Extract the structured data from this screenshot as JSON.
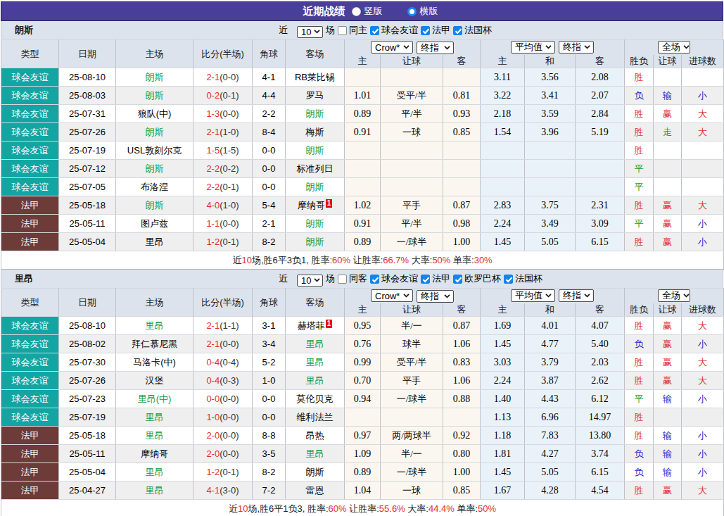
{
  "title_bar": {
    "title": "近期战绩",
    "radios": [
      {
        "label": "竖版",
        "selected": false
      },
      {
        "label": "横版",
        "selected": true
      }
    ]
  },
  "table_header": {
    "left_cols": [
      "类型",
      "日期",
      "主场",
      "比分(半场)",
      "角球",
      "客场"
    ],
    "odds_group": {
      "selects": [
        "Crow*",
        "终指"
      ],
      "cols": [
        "主",
        "让球",
        "客"
      ]
    },
    "avg_group": {
      "selects": [
        "平均值",
        "终指"
      ],
      "cols": [
        "主",
        "和",
        "客"
      ]
    },
    "result_group": {
      "selects": [
        "全场"
      ],
      "cols": [
        "胜负",
        "让球",
        "进球数"
      ]
    }
  },
  "sections": [
    {
      "team": "朗斯",
      "filter": {
        "near_label": "近",
        "count": "10",
        "unit_label": "场",
        "checkboxes": [
          {
            "label": "同主",
            "checked": false
          },
          {
            "label": "球会友谊",
            "checked": true
          },
          {
            "label": "法甲",
            "checked": true
          },
          {
            "label": "法国杯",
            "checked": true
          }
        ]
      },
      "rows": [
        {
          "type": "球会友谊",
          "type_class": "friendly",
          "date": "25-08-10",
          "home": "朗斯",
          "home_focal": true,
          "score_ft": "2-1",
          "score_ht": "(0-0)",
          "corner": "4-1",
          "away": "RB莱比锡",
          "away_focal": false,
          "away_sup": "",
          "odds": [
            "",
            "",
            ""
          ],
          "avg": [
            "3.11",
            "3.56",
            "2.08"
          ],
          "results": [
            [
              "胜",
              "red"
            ],
            [
              "",
              ""
            ],
            [
              "",
              ""
            ]
          ]
        },
        {
          "type": "球会友谊",
          "type_class": "friendly",
          "date": "25-08-03",
          "home": "朗斯",
          "home_focal": true,
          "score_ft": "0-2",
          "score_ht": "(0-1)",
          "corner": "4-4",
          "away": "罗马",
          "away_focal": false,
          "away_sup": "",
          "odds": [
            "1.01",
            "受平/半",
            "0.81"
          ],
          "avg": [
            "3.22",
            "3.41",
            "2.07"
          ],
          "results": [
            [
              "负",
              "blue"
            ],
            [
              "输",
              "blue"
            ],
            [
              "小",
              "blue"
            ]
          ]
        },
        {
          "type": "球会友谊",
          "type_class": "friendly",
          "date": "25-07-31",
          "home": "狼队(中)",
          "home_focal": false,
          "score_ft": "1-3",
          "score_ht": "(0-0)",
          "corner": "2-2",
          "away": "朗斯",
          "away_focal": true,
          "away_sup": "",
          "odds": [
            "0.89",
            "平/半",
            "0.93"
          ],
          "avg": [
            "2.18",
            "3.59",
            "2.84"
          ],
          "results": [
            [
              "胜",
              "red"
            ],
            [
              "赢",
              "red"
            ],
            [
              "大",
              "red"
            ]
          ]
        },
        {
          "type": "球会友谊",
          "type_class": "friendly",
          "date": "25-07-26",
          "home": "朗斯",
          "home_focal": true,
          "score_ft": "2-1",
          "score_ht": "(1-0)",
          "corner": "8-4",
          "away": "梅斯",
          "away_focal": false,
          "away_sup": "",
          "odds": [
            "0.91",
            "一球",
            "0.85"
          ],
          "avg": [
            "1.54",
            "3.96",
            "5.19"
          ],
          "results": [
            [
              "胜",
              "red"
            ],
            [
              "走",
              "green"
            ],
            [
              "大",
              "red"
            ]
          ]
        },
        {
          "type": "球会友谊",
          "type_class": "friendly",
          "date": "25-07-19",
          "home": "USL敦刻尔克",
          "home_focal": false,
          "score_ft": "1-5",
          "score_ht": "(1-5)",
          "corner": "0-0",
          "away": "朗斯",
          "away_focal": true,
          "away_sup": "",
          "odds": [
            "",
            "",
            ""
          ],
          "avg": [
            "",
            "",
            ""
          ],
          "results": [
            [
              "胜",
              "red"
            ],
            [
              "",
              ""
            ],
            [
              "",
              ""
            ]
          ]
        },
        {
          "type": "球会友谊",
          "type_class": "friendly",
          "date": "25-07-12",
          "home": "朗斯",
          "home_focal": true,
          "score_ft": "2-2",
          "score_ht": "(0-2)",
          "corner": "0-0",
          "away": "标准列日",
          "away_focal": false,
          "away_sup": "",
          "odds": [
            "",
            "",
            ""
          ],
          "avg": [
            "",
            "",
            ""
          ],
          "results": [
            [
              "平",
              "green"
            ],
            [
              "",
              ""
            ],
            [
              "",
              ""
            ]
          ]
        },
        {
          "type": "球会友谊",
          "type_class": "friendly",
          "date": "25-07-05",
          "home": "布洛涅",
          "home_focal": false,
          "score_ft": "2-2",
          "score_ht": "(0-1)",
          "corner": "0-0",
          "away": "朗斯",
          "away_focal": true,
          "away_sup": "",
          "odds": [
            "",
            "",
            ""
          ],
          "avg": [
            "",
            "",
            ""
          ],
          "results": [
            [
              "平",
              "green"
            ],
            [
              "",
              ""
            ],
            [
              "",
              ""
            ]
          ]
        },
        {
          "type": "法甲",
          "type_class": "ligue1",
          "date": "25-05-18",
          "home": "朗斯",
          "home_focal": true,
          "score_ft": "4-0",
          "score_ht": "(1-0)",
          "corner": "5-4",
          "away": "摩纳哥",
          "away_focal": false,
          "away_sup": "1",
          "odds": [
            "1.02",
            "平手",
            "0.87"
          ],
          "avg": [
            "2.83",
            "3.75",
            "2.31"
          ],
          "results": [
            [
              "胜",
              "red"
            ],
            [
              "赢",
              "red"
            ],
            [
              "大",
              "red"
            ]
          ]
        },
        {
          "type": "法甲",
          "type_class": "ligue1",
          "date": "25-05-11",
          "home": "图卢兹",
          "home_focal": false,
          "score_ft": "1-1",
          "score_ht": "(0-0)",
          "corner": "2-1",
          "away": "朗斯",
          "away_focal": true,
          "away_sup": "",
          "odds": [
            "0.91",
            "平/半",
            "0.98"
          ],
          "avg": [
            "2.24",
            "3.49",
            "3.09"
          ],
          "results": [
            [
              "平",
              "green"
            ],
            [
              "赢",
              "red"
            ],
            [
              "小",
              "blue"
            ]
          ]
        },
        {
          "type": "法甲",
          "type_class": "ligue1",
          "date": "25-05-04",
          "home": "里昂",
          "home_focal": false,
          "score_ft": "1-2",
          "score_ht": "(0-1)",
          "corner": "8-2",
          "away": "朗斯",
          "away_focal": true,
          "away_sup": "",
          "odds": [
            "0.89",
            "一/球半",
            "1.00"
          ],
          "avg": [
            "1.45",
            "5.05",
            "6.15"
          ],
          "results": [
            [
              "胜",
              "red"
            ],
            [
              "赢",
              "red"
            ],
            [
              "小",
              "blue"
            ]
          ]
        }
      ],
      "summary": [
        [
          "近",
          ""
        ],
        [
          "10",
          "red"
        ],
        [
          "场,胜6平3负1, 胜率:",
          ""
        ],
        [
          "60%",
          "red"
        ],
        [
          " 让胜率:",
          ""
        ],
        [
          "66.7%",
          "red"
        ],
        [
          " 大率:",
          ""
        ],
        [
          "50%",
          "red"
        ],
        [
          " 单率:",
          ""
        ],
        [
          "30%",
          "red"
        ]
      ]
    },
    {
      "team": "里昂",
      "filter": {
        "near_label": "近",
        "count": "10",
        "unit_label": "场",
        "checkboxes": [
          {
            "label": "同客",
            "checked": false
          },
          {
            "label": "球会友谊",
            "checked": true
          },
          {
            "label": "法甲",
            "checked": true
          },
          {
            "label": "欧罗巴杯",
            "checked": true
          },
          {
            "label": "法国杯",
            "checked": true
          }
        ]
      },
      "rows": [
        {
          "type": "球会友谊",
          "type_class": "friendly",
          "date": "25-08-10",
          "home": "里昂",
          "home_focal": true,
          "score_ft": "2-1",
          "score_ht": "(1-1)",
          "corner": "3-1",
          "away": "赫塔菲",
          "away_focal": false,
          "away_sup": "1",
          "odds": [
            "0.95",
            "半/一",
            "0.87"
          ],
          "avg": [
            "1.69",
            "4.01",
            "4.07"
          ],
          "results": [
            [
              "胜",
              "red"
            ],
            [
              "赢",
              "red"
            ],
            [
              "大",
              "red"
            ]
          ]
        },
        {
          "type": "球会友谊",
          "type_class": "friendly",
          "date": "25-08-02",
          "home": "拜仁慕尼黑",
          "home_focal": false,
          "score_ft": "2-1",
          "score_ht": "(0-0)",
          "corner": "3-4",
          "away": "里昂",
          "away_focal": true,
          "away_sup": "",
          "odds": [
            "0.76",
            "球半",
            "1.06"
          ],
          "avg": [
            "1.45",
            "4.77",
            "5.40"
          ],
          "results": [
            [
              "负",
              "blue"
            ],
            [
              "赢",
              "red"
            ],
            [
              "小",
              "blue"
            ]
          ]
        },
        {
          "type": "球会友谊",
          "type_class": "friendly",
          "date": "25-07-30",
          "home": "马洛卡(中)",
          "home_focal": false,
          "score_ft": "0-4",
          "score_ht": "(0-4)",
          "corner": "5-2",
          "away": "里昂",
          "away_focal": true,
          "away_sup": "",
          "odds": [
            "0.99",
            "受平/半",
            "0.83"
          ],
          "avg": [
            "3.03",
            "3.79",
            "2.03"
          ],
          "results": [
            [
              "胜",
              "red"
            ],
            [
              "赢",
              "red"
            ],
            [
              "大",
              "red"
            ]
          ]
        },
        {
          "type": "球会友谊",
          "type_class": "friendly",
          "date": "25-07-26",
          "home": "汉堡",
          "home_focal": false,
          "score_ft": "0-4",
          "score_ht": "(0-3)",
          "corner": "1-0",
          "away": "里昂",
          "away_focal": true,
          "away_sup": "",
          "odds": [
            "0.70",
            "平手",
            "1.06"
          ],
          "avg": [
            "2.24",
            "3.87",
            "2.62"
          ],
          "results": [
            [
              "胜",
              "red"
            ],
            [
              "赢",
              "red"
            ],
            [
              "大",
              "red"
            ]
          ]
        },
        {
          "type": "球会友谊",
          "type_class": "friendly",
          "date": "25-07-23",
          "home": "里昂(中)",
          "home_focal": true,
          "score_ft": "0-0",
          "score_ht": "(0-0)",
          "corner": "0-0",
          "away": "莫伦贝克",
          "away_focal": false,
          "away_sup": "",
          "odds": [
            "0.94",
            "一/球半",
            "0.88"
          ],
          "avg": [
            "1.40",
            "4.43",
            "6.12"
          ],
          "results": [
            [
              "平",
              "green"
            ],
            [
              "输",
              "blue"
            ],
            [
              "小",
              "blue"
            ]
          ]
        },
        {
          "type": "球会友谊",
          "type_class": "friendly",
          "date": "25-07-19",
          "home": "里昂",
          "home_focal": true,
          "score_ft": "1-0",
          "score_ht": "(0-0)",
          "corner": "0-0",
          "away": "维利法兰",
          "away_focal": false,
          "away_sup": "",
          "odds": [
            "",
            "",
            ""
          ],
          "avg": [
            "1.13",
            "6.96",
            "14.97"
          ],
          "results": [
            [
              "胜",
              "red"
            ],
            [
              "",
              ""
            ],
            [
              "",
              ""
            ]
          ]
        },
        {
          "type": "法甲",
          "type_class": "ligue1",
          "date": "25-05-18",
          "home": "里昂",
          "home_focal": true,
          "score_ft": "2-0",
          "score_ht": "(0-0)",
          "corner": "8-8",
          "away": "昂热",
          "away_focal": false,
          "away_sup": "",
          "odds": [
            "0.97",
            "两/两球半",
            "0.92"
          ],
          "avg": [
            "1.18",
            "7.83",
            "13.80"
          ],
          "results": [
            [
              "胜",
              "red"
            ],
            [
              "输",
              "blue"
            ],
            [
              "小",
              "blue"
            ]
          ]
        },
        {
          "type": "法甲",
          "type_class": "ligue1",
          "date": "25-05-11",
          "home": "摩纳哥",
          "home_focal": false,
          "score_ft": "2-0",
          "score_ht": "(0-0)",
          "corner": "3-5",
          "away": "里昂",
          "away_focal": true,
          "away_sup": "",
          "odds": [
            "1.09",
            "半/一",
            "0.80"
          ],
          "avg": [
            "1.81",
            "4.27",
            "3.74"
          ],
          "results": [
            [
              "负",
              "blue"
            ],
            [
              "输",
              "blue"
            ],
            [
              "小",
              "blue"
            ]
          ]
        },
        {
          "type": "法甲",
          "type_class": "ligue1",
          "date": "25-05-04",
          "home": "里昂",
          "home_focal": true,
          "score_ft": "1-2",
          "score_ht": "(0-1)",
          "corner": "8-2",
          "away": "朗斯",
          "away_focal": false,
          "away_sup": "",
          "odds": [
            "0.89",
            "一/球半",
            "1.00"
          ],
          "avg": [
            "1.45",
            "5.05",
            "6.15"
          ],
          "results": [
            [
              "负",
              "blue"
            ],
            [
              "输",
              "blue"
            ],
            [
              "小",
              "blue"
            ]
          ]
        },
        {
          "type": "法甲",
          "type_class": "ligue1",
          "date": "25-04-27",
          "home": "里昂",
          "home_focal": true,
          "score_ft": "4-1",
          "score_ht": "(3-0)",
          "corner": "7-2",
          "away": "雷恩",
          "away_focal": false,
          "away_sup": "",
          "odds": [
            "1.04",
            "一球",
            "0.85"
          ],
          "avg": [
            "1.67",
            "4.28",
            "4.54"
          ],
          "results": [
            [
              "胜",
              "red"
            ],
            [
              "赢",
              "red"
            ],
            [
              "大",
              "red"
            ]
          ]
        }
      ],
      "summary": [
        [
          "近",
          ""
        ],
        [
          "10",
          "red"
        ],
        [
          "场,胜6平1负3, 胜率:",
          ""
        ],
        [
          "60%",
          "red"
        ],
        [
          " 让胜率:",
          ""
        ],
        [
          "55.6%",
          "red"
        ],
        [
          " 大率:",
          ""
        ],
        [
          "44.4%",
          "red"
        ],
        [
          " 单率:",
          ""
        ],
        [
          "50%",
          "red"
        ]
      ]
    }
  ]
}
